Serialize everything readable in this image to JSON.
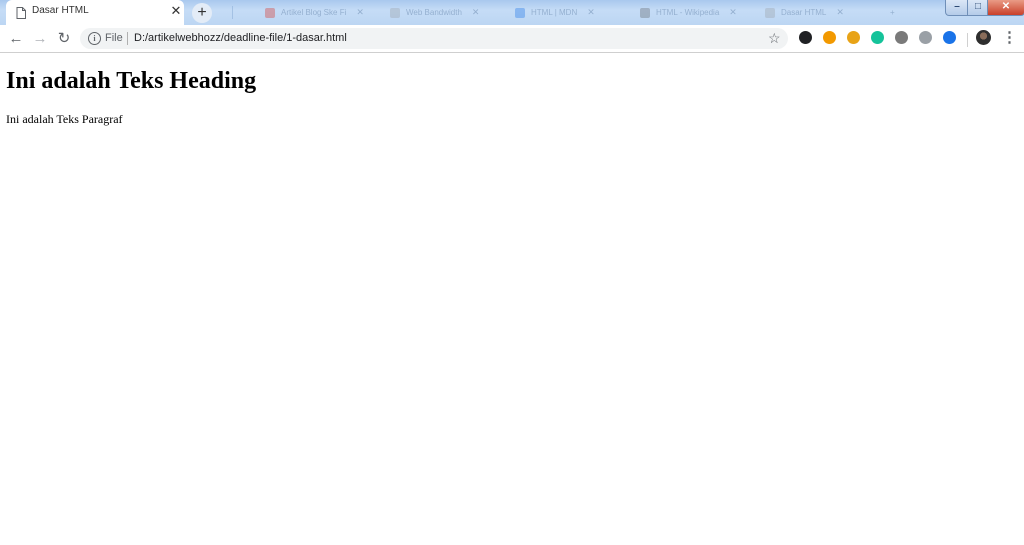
{
  "browser": {
    "active_tab": {
      "title": "Dasar HTML",
      "close_glyph": "✕",
      "icon": "document-icon"
    },
    "new_tab_glyph": "+",
    "background_tabs": [
      {
        "title": "Artikel Blog Ske Fi",
        "icon_color": "#d93025"
      },
      {
        "title": "Web Bandwidth",
        "icon_color": "#9aa0a6"
      },
      {
        "title": "HTML | MDN",
        "icon_color": "#1a73e8"
      },
      {
        "title": "HTML - Wikipedia",
        "icon_color": "#5f6368"
      },
      {
        "title": "Dasar HTML",
        "icon_color": "#9aa0a6"
      }
    ],
    "window_controls": {
      "minimize": "–",
      "maximize": "□",
      "close": "✕"
    },
    "toolbar": {
      "back": "←",
      "forward": "→",
      "reload": "↻",
      "info_glyph": "i",
      "scheme_label": "File",
      "url": "D:/artikelwebhozz/deadline-file/1-dasar.html",
      "bookmark_glyph": "☆",
      "menu_glyph": "⋮"
    },
    "extensions": [
      {
        "name": "extension-dark-icon",
        "color": "#202124"
      },
      {
        "name": "extension-orange-icon",
        "color": "#f29900"
      },
      {
        "name": "extension-sun-icon",
        "color": "#e8a317"
      },
      {
        "name": "extension-grammarly-icon",
        "color": "#15c39a"
      },
      {
        "name": "extension-gray-icon",
        "color": "#7a7a7a"
      },
      {
        "name": "extension-puzzle-icon",
        "color": "#9aa0a6"
      },
      {
        "name": "extension-c-icon",
        "color": "#1a73e8"
      }
    ]
  },
  "page": {
    "heading": "Ini adalah Teks Heading",
    "paragraph": "Ini adalah Teks Paragraf"
  }
}
